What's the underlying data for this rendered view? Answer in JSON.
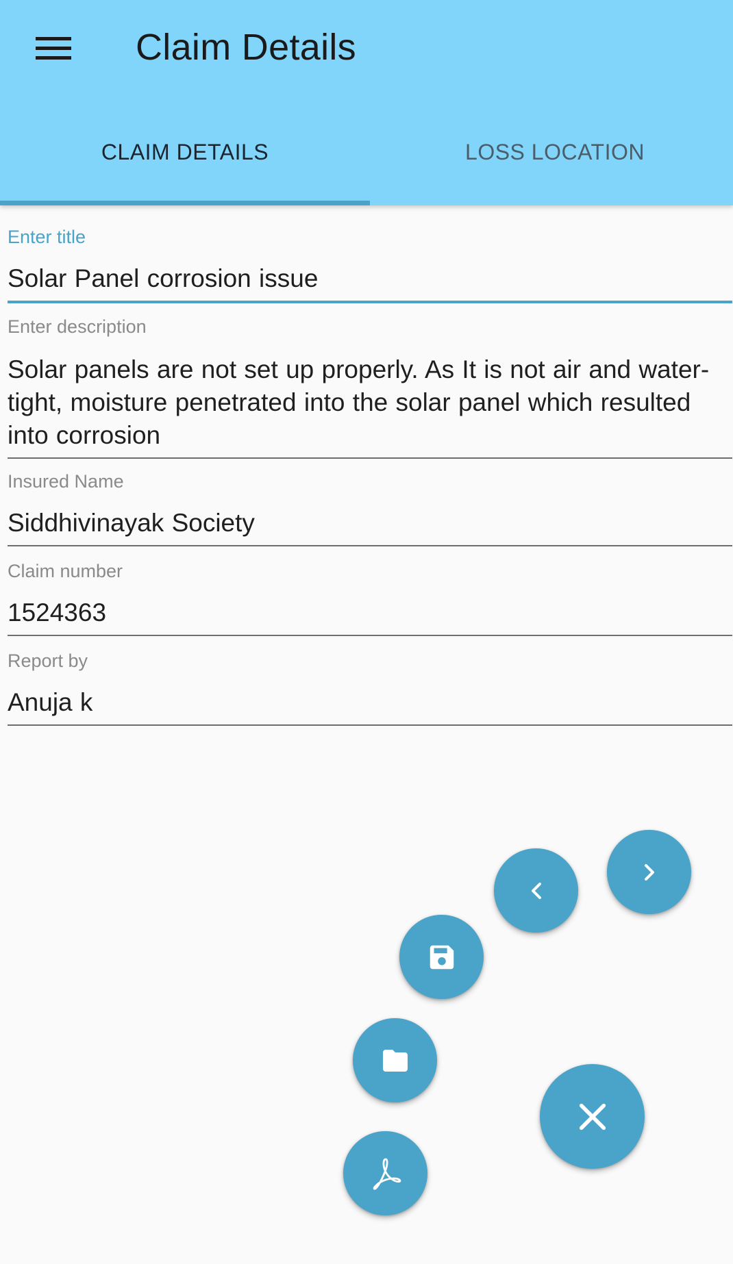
{
  "app_bar": {
    "title": "Claim Details",
    "menu_icon": "hamburger-menu-icon"
  },
  "tabs": [
    {
      "label": "CLAIM DETAILS",
      "selected": true
    },
    {
      "label": "LOSS LOCATION",
      "selected": false
    }
  ],
  "form": {
    "title_field": {
      "label": "Enter title",
      "value": "Solar Panel corrosion issue"
    },
    "description_field": {
      "label": "Enter description",
      "value": "Solar panels are not set up properly. As It is not air  and water-tight, moisture penetrated into the solar panel  which resulted into corrosion"
    },
    "insured_name_field": {
      "label": "Insured Name",
      "value": "Siddhivinayak Society"
    },
    "claim_number_field": {
      "label": "Claim number",
      "value": "1524363"
    },
    "report_by_field": {
      "label": "Report by",
      "value": "Anuja k"
    }
  },
  "fab_menu": {
    "buttons": [
      {
        "name": "next-button",
        "icon": "chevron-right-icon"
      },
      {
        "name": "previous-button",
        "icon": "chevron-left-icon"
      },
      {
        "name": "save-button",
        "icon": "save-disk-icon"
      },
      {
        "name": "folder-button",
        "icon": "folder-icon"
      },
      {
        "name": "pdf-button",
        "icon": "acrobat-pdf-icon"
      },
      {
        "name": "close-menu-button",
        "icon": "close-icon"
      }
    ]
  },
  "colors": {
    "app_bar": "#81d4fa",
    "accent": "#4aa3c8",
    "background": "#fafafa"
  }
}
